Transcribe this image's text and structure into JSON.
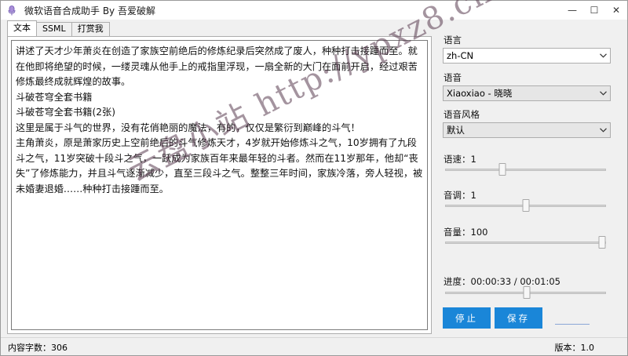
{
  "window": {
    "title": "微软语音合成助手 By 吾爱破解",
    "minimize_glyph": "—",
    "maximize_glyph": "☐",
    "close_glyph": "✕"
  },
  "tabs": [
    {
      "label": "文本",
      "active": true
    },
    {
      "label": "SSML",
      "active": false
    },
    {
      "label": "打赏我",
      "active": false
    }
  ],
  "text_content": {
    "paragraphs": [
      "讲述了天才少年萧炎在创造了家族空前绝后的修炼纪录后突然成了废人，种种打击接踵而至。就在他即将绝望的时候，一缕灵魂从他手上的戒指里浮现，一扇全新的大门在面前开启，经过艰苦修炼最终成就辉煌的故事。",
      "斗破苍穹全套书籍",
      "斗破苍穹全套书籍(2张)",
      "这里是属于斗气的世界，没有花俏艳丽的魔法，有的，仅仅是繁衍到巅峰的斗气！",
      "主角萧炎，原是萧家历史上空前绝后的斗气修炼天才，4岁就开始修炼斗之气，10岁拥有了九段斗之气，11岁突破十段斗之气，一跃成为家族百年来最年轻的斗者。然而在11岁那年，他却“丧失”了修炼能力，并且斗气逐渐减少，直至三段斗之气。整整三年时间，家族冷落，旁人轻视，被未婚妻退婚……种种打击接踵而至。"
    ]
  },
  "panel": {
    "language_label": "语言",
    "language_value": "zh-CN",
    "voice_label": "语音",
    "voice_value": "Xiaoxiao - 晓晓",
    "style_label": "语音风格",
    "style_value": "默认",
    "speed_label": "语速：1",
    "speed_level": 0.35,
    "pitch_label": "音调：1",
    "pitch_level": 0.5,
    "volume_label": "音量：100",
    "volume_level": 1.0,
    "progress_label": "进度：00:00:33 / 00:01:05",
    "progress_level": 0.51,
    "stop_button": "停止",
    "save_button": "保存"
  },
  "status": {
    "char_count": "内容字数：306",
    "version": "版本：1.0"
  },
  "watermark": {
    "text": "云盘小站 http://ypxz8.cn"
  },
  "colors": {
    "accent": "#1a86d8",
    "title_bg": "#ffffff",
    "window_bg": "#f0f0f0"
  }
}
